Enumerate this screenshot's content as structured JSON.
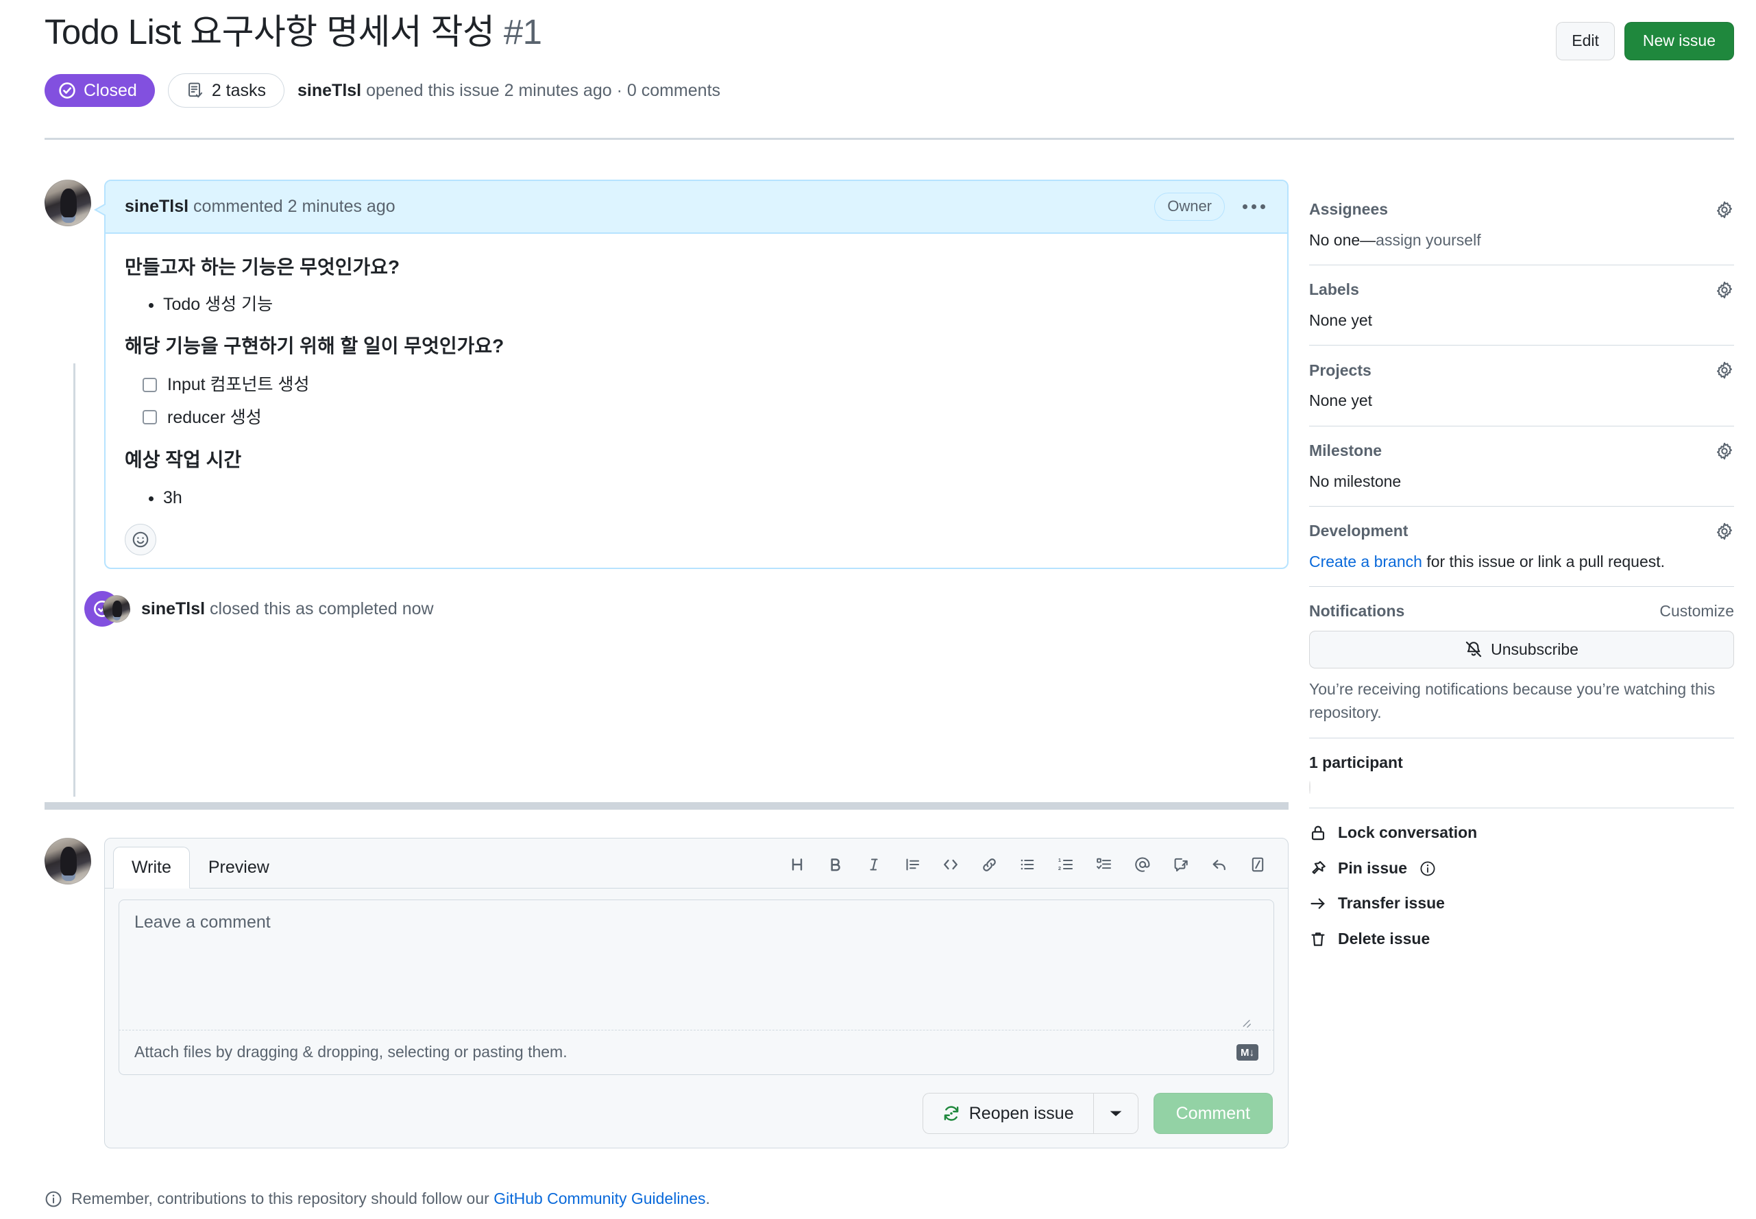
{
  "header": {
    "title": "Todo List 요구사항 명세서 작성",
    "number": "#1",
    "edit_label": "Edit",
    "new_issue_label": "New issue",
    "state": "Closed",
    "tasks_badge": "2 tasks",
    "meta_author": "sineTlsl",
    "meta_rest": " opened this issue 2 minutes ago · 0 comments"
  },
  "comment": {
    "author": "sineTlsl",
    "action": " commented 2 minutes ago",
    "role_badge": "Owner",
    "heading1": "만들고자 하는 기능은 무엇인가요?",
    "bullets1": [
      "Todo 생성 기능"
    ],
    "heading2": "해당 기능을 구현하기 위해 할 일이 무엇인가요?",
    "tasks": [
      {
        "label": "Input 컴포넌트 생성",
        "checked": false
      },
      {
        "label": "reducer 생성",
        "checked": false
      }
    ],
    "heading3": "예상 작업 시간",
    "bullets3": [
      "3h"
    ]
  },
  "event": {
    "author": "sineTlsl",
    "text": " closed this as completed now"
  },
  "form": {
    "tabs": [
      {
        "label": "Write",
        "active": true
      },
      {
        "label": "Preview",
        "active": false
      }
    ],
    "toolbar": [
      {
        "name": "heading-icon",
        "glyph": "H"
      },
      {
        "name": "bold-icon",
        "glyph": "B"
      },
      {
        "name": "italic-icon",
        "glyph": "I"
      },
      {
        "name": "quote-icon",
        "glyph": ""
      },
      {
        "name": "code-icon",
        "glyph": "<>"
      },
      {
        "name": "link-icon",
        "glyph": ""
      },
      {
        "name": "unordered-list-icon",
        "glyph": ""
      },
      {
        "name": "ordered-list-icon",
        "glyph": ""
      },
      {
        "name": "task-list-icon",
        "glyph": ""
      },
      {
        "name": "mention-icon",
        "glyph": "@"
      },
      {
        "name": "cross-reference-icon",
        "glyph": ""
      },
      {
        "name": "saved-reply-icon",
        "glyph": ""
      },
      {
        "name": "slash-command-icon",
        "glyph": ""
      }
    ],
    "placeholder": "Leave a comment",
    "value": "",
    "attach_text": "Attach files by dragging & dropping, selecting or pasting them.",
    "markdown_badge": "M↓",
    "reopen_label": "Reopen issue",
    "comment_label": "Comment",
    "note_prefix": "Remember, contributions to this repository should follow our ",
    "note_link": "GitHub Community Guidelines",
    "note_suffix": "."
  },
  "sidebar": {
    "assignees": {
      "title": "Assignees",
      "value_plain": "No one—",
      "value_link": "assign yourself"
    },
    "labels": {
      "title": "Labels",
      "value": "None yet"
    },
    "projects": {
      "title": "Projects",
      "value": "None yet"
    },
    "milestone": {
      "title": "Milestone",
      "value": "No milestone"
    },
    "development": {
      "title": "Development",
      "link": "Create a branch",
      "rest": " for this issue or link a pull request."
    },
    "notifications": {
      "title": "Notifications",
      "customize": "Customize",
      "unsubscribe": "Unsubscribe",
      "note": "You’re receiving notifications because you’re watching this repository."
    },
    "participants": {
      "title": "1 participant"
    },
    "actions": [
      {
        "label": "Lock conversation",
        "icon": "lock-icon",
        "has_info": false
      },
      {
        "label": "Pin issue",
        "icon": "pin-icon",
        "has_info": true
      },
      {
        "label": "Transfer issue",
        "icon": "arrow-right-icon",
        "has_info": false
      },
      {
        "label": "Delete issue",
        "icon": "trash-icon",
        "has_info": false
      }
    ]
  },
  "colors": {
    "closed_purple": "#8250df",
    "green": "#1f883d",
    "link_blue": "#0969da",
    "comment_blue_bg": "#ddf4ff",
    "comment_blue_border": "#b6e3ff"
  }
}
